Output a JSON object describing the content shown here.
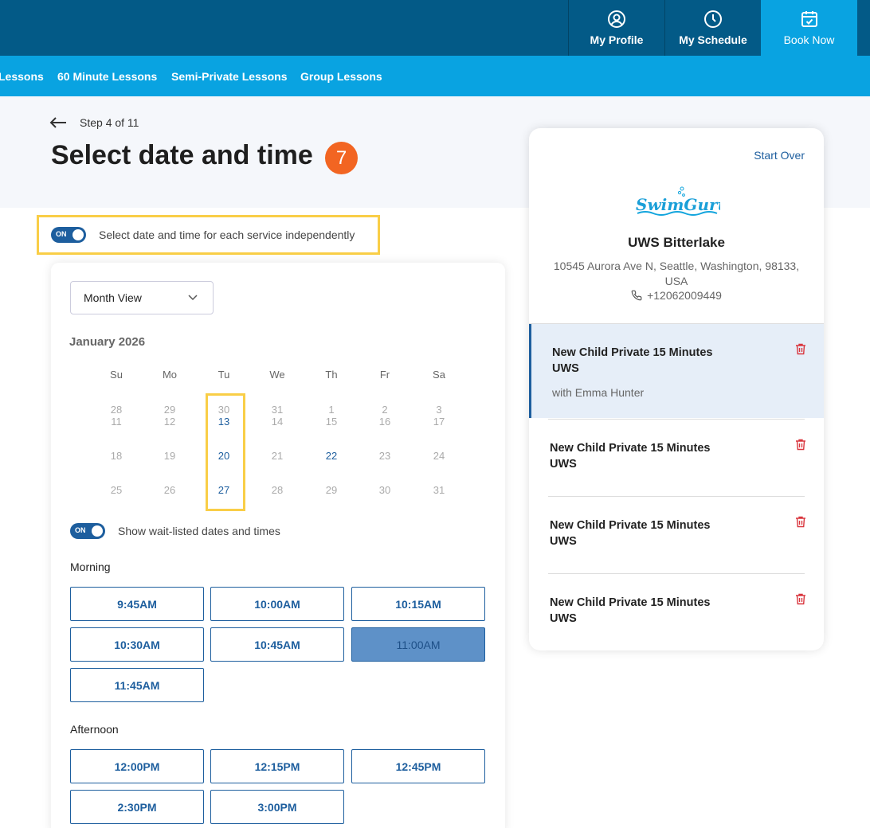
{
  "top_nav": {
    "profile": "My Profile",
    "schedule": "My Schedule",
    "book": "Book Now"
  },
  "sub_nav": [
    "Lessons",
    "60 Minute Lessons",
    "Semi-Private Lessons",
    "Group Lessons"
  ],
  "header": {
    "step": "Step 4 of 11",
    "title": "Select date and time",
    "badge": "7"
  },
  "independent_toggle": {
    "state": "ON",
    "label": "Select date and time for each service independently"
  },
  "calendar": {
    "view": "Month View",
    "month": "January 2026",
    "weekdays": [
      "Su",
      "Mo",
      "Tu",
      "We",
      "Th",
      "Fr",
      "Sa"
    ],
    "row1_top": [
      "28",
      "29",
      "30",
      "31",
      "1",
      "2",
      "3"
    ],
    "row1_bottom": [
      "11",
      "12",
      "13",
      "14",
      "15",
      "16",
      "17"
    ],
    "row2": [
      "18",
      "19",
      "20",
      "21",
      "22",
      "23",
      "24"
    ],
    "row3": [
      "25",
      "26",
      "27",
      "28",
      "29",
      "30",
      "31"
    ]
  },
  "waitlist_toggle": {
    "state": "ON",
    "label": "Show wait-listed dates and times"
  },
  "morning": {
    "label": "Morning",
    "slots": [
      "9:45AM",
      "10:00AM",
      "10:15AM",
      "10:30AM",
      "10:45AM",
      "11:00AM",
      "11:45AM"
    ],
    "selected": "11:00AM"
  },
  "afternoon": {
    "label": "Afternoon",
    "slots": [
      "12:00PM",
      "12:15PM",
      "12:45PM",
      "2:30PM",
      "3:00PM"
    ]
  },
  "summary": {
    "start_over": "Start Over",
    "logo_text": "SwimGuru",
    "location": "UWS Bitterlake",
    "address": "10545 Aurora Ave N, Seattle, Washington, 98133, USA",
    "phone": "+12062009449",
    "services": [
      {
        "line1": "New Child Private 15 Minutes",
        "line2": "UWS",
        "instructor": "with Emma Hunter"
      },
      {
        "line1": "New Child Private 15 Minutes",
        "line2": "UWS"
      },
      {
        "line1": "New Child Private 15 Minutes",
        "line2": "UWS"
      },
      {
        "line1": "New Child Private 15 Minutes",
        "line2": "UWS"
      }
    ]
  },
  "colors": {
    "top_bar": "#035a87",
    "sub_nav": "#09a3e1",
    "accent": "#1d5e9e",
    "badge": "#f26522",
    "highlight": "#f9ce47",
    "selected_slot": "#5e91c8",
    "trash": "#d9363e"
  }
}
